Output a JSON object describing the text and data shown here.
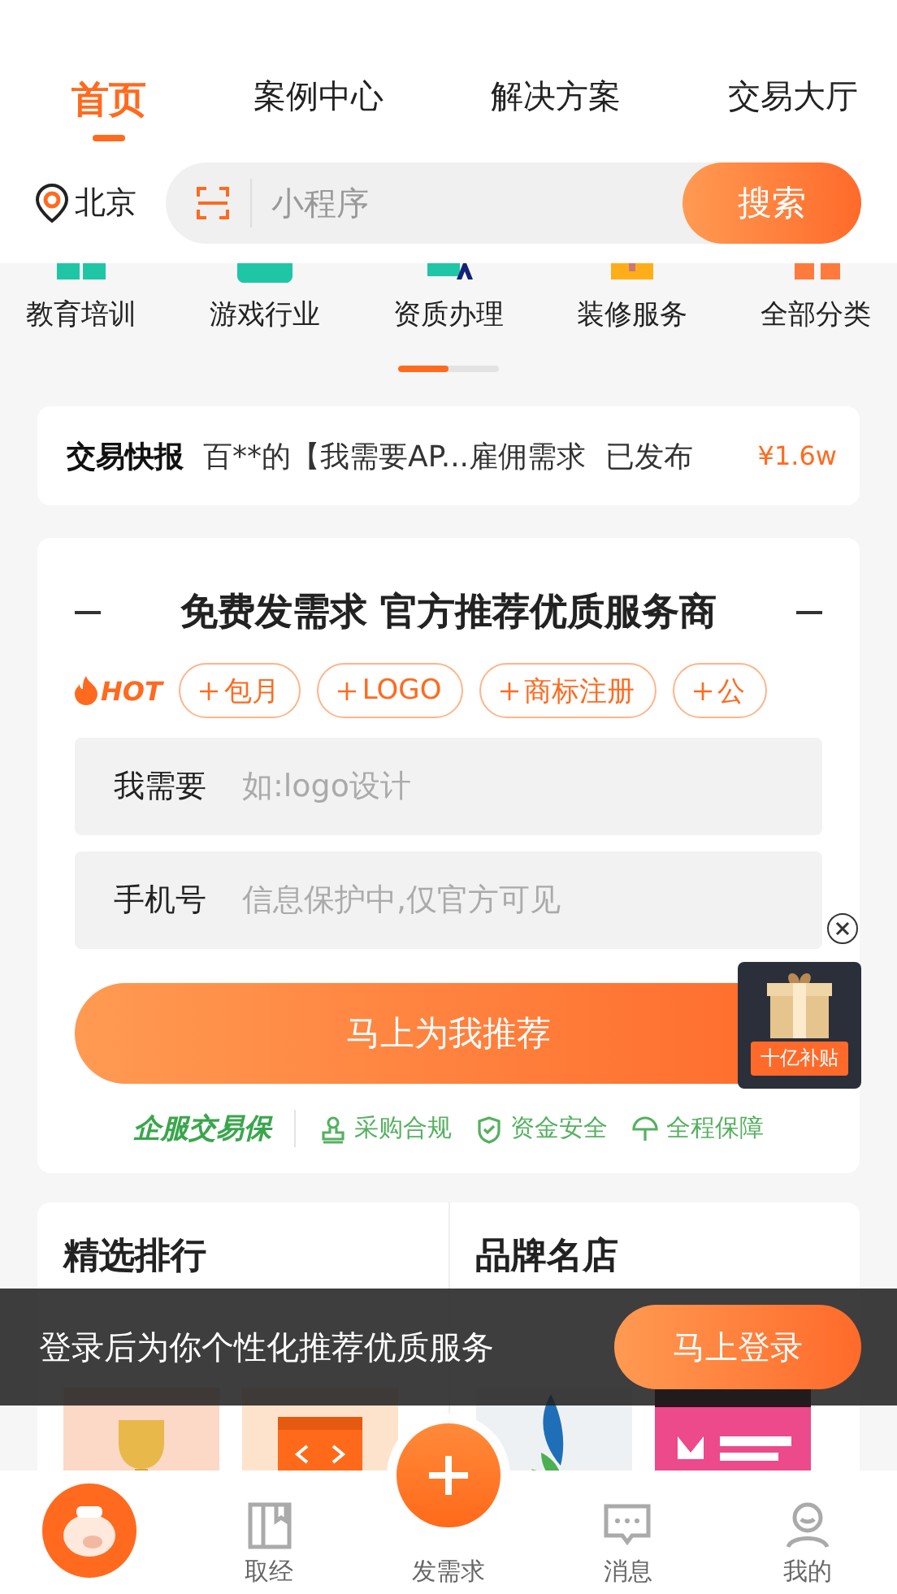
{
  "tabs": [
    {
      "label": "首页",
      "selected": true
    },
    {
      "label": "案例中心",
      "selected": false
    },
    {
      "label": "解决方案",
      "selected": false
    },
    {
      "label": "交易大厅",
      "selected": false
    }
  ],
  "location": "北京",
  "search": {
    "placeholder": "小程序",
    "button": "搜索"
  },
  "categories": [
    {
      "label": "教育培训",
      "color": "#1fc6a6"
    },
    {
      "label": "游戏行业",
      "color": "#1fc6a6"
    },
    {
      "label": "资质办理",
      "color": "#1fc6a6"
    },
    {
      "label": "装修服务",
      "color": "#ffae1a"
    },
    {
      "label": "全部分类",
      "color": "#ff7a3d"
    }
  ],
  "category_pager": {
    "level": 0.5
  },
  "ticker": {
    "label": "交易快报",
    "text": "百**的【我需要AP...雇佣需求",
    "status": "已发布",
    "amount": "¥1.6w"
  },
  "demand_form": {
    "title": "免费发需求 官方推荐优质服务商",
    "hot": "HOT",
    "chips": [
      "包月",
      "LOGO",
      "商标注册",
      "公"
    ],
    "fields": [
      {
        "label": "我需要",
        "placeholder": "如:logo设计"
      },
      {
        "label": "手机号",
        "placeholder": "信息保护中,仅官方可见"
      }
    ],
    "submit": "马上为我推荐",
    "guarantee_logo": "企服交易保",
    "guarantees": [
      {
        "label": "采购合规",
        "kind": "stamp"
      },
      {
        "label": "资金安全",
        "kind": "shield"
      },
      {
        "label": "全程保障",
        "kind": "umbrella"
      }
    ]
  },
  "promo": {
    "badge": "十亿补贴"
  },
  "rankings": [
    {
      "title": "精选排行",
      "items": [
        {
          "kind": "trophy"
        },
        {
          "kind": "code"
        }
      ]
    },
    {
      "title": "品牌名店",
      "items": [
        {
          "kind": "leaf"
        },
        {
          "kind": "pink"
        }
      ]
    }
  ],
  "login_banner": {
    "text": "登录后为你个性化推荐优质服务",
    "button": "马上登录"
  },
  "nav": [
    {
      "kind": "avatar",
      "selected": true
    },
    {
      "kind": "book",
      "label": "取经",
      "selected": false
    },
    {
      "kind": "plus",
      "label": "发需求",
      "selected": false
    },
    {
      "kind": "chat",
      "label": "消息",
      "selected": false
    },
    {
      "kind": "person",
      "label": "我的",
      "selected": false
    }
  ]
}
